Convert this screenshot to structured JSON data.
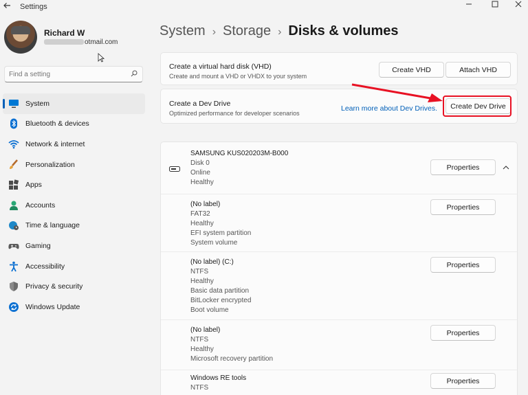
{
  "app": {
    "title": "Settings"
  },
  "user": {
    "name": "Richard W",
    "email_visible_part": "otmail.com"
  },
  "search": {
    "placeholder": "Find a setting"
  },
  "nav": [
    {
      "label": "System",
      "icon": "monitor-icon",
      "active": true
    },
    {
      "label": "Bluetooth & devices",
      "icon": "bluetooth-icon"
    },
    {
      "label": "Network & internet",
      "icon": "wifi-icon"
    },
    {
      "label": "Personalization",
      "icon": "brush-icon"
    },
    {
      "label": "Apps",
      "icon": "apps-icon"
    },
    {
      "label": "Accounts",
      "icon": "person-icon"
    },
    {
      "label": "Time & language",
      "icon": "globe-clock-icon"
    },
    {
      "label": "Gaming",
      "icon": "gamepad-icon"
    },
    {
      "label": "Accessibility",
      "icon": "accessibility-icon"
    },
    {
      "label": "Privacy & security",
      "icon": "shield-icon"
    },
    {
      "label": "Windows Update",
      "icon": "update-icon"
    }
  ],
  "breadcrumb": [
    "System",
    "Storage",
    "Disks & volumes"
  ],
  "vhd": {
    "title": "Create a virtual hard disk (VHD)",
    "subtitle": "Create and mount a VHD or VHDX to your system",
    "create_label": "Create VHD",
    "attach_label": "Attach VHD"
  },
  "devdrive": {
    "title": "Create a Dev Drive",
    "subtitle": "Optimized performance for developer scenarios",
    "link_label": "Learn more about Dev Drives.",
    "button_label": "Create Dev Drive"
  },
  "disk": {
    "lines": [
      "SAMSUNG KUS020203M-B000",
      "Disk 0",
      "Online",
      "Healthy"
    ],
    "button_label": "Properties",
    "expanded": true
  },
  "volumes": [
    {
      "lines": [
        "(No label)",
        "FAT32",
        "Healthy",
        "EFI system partition",
        "System volume"
      ],
      "button_label": "Properties"
    },
    {
      "lines": [
        "(No label) (C:)",
        "NTFS",
        "Healthy",
        "Basic data partition",
        "BitLocker encrypted",
        "Boot volume"
      ],
      "button_label": "Properties"
    },
    {
      "lines": [
        "(No label)",
        "NTFS",
        "Healthy",
        "Microsoft recovery partition"
      ],
      "button_label": "Properties"
    },
    {
      "lines": [
        "Windows RE tools",
        "NTFS"
      ],
      "button_label": "Properties"
    }
  ],
  "colors": {
    "accent": "#005fb8",
    "highlight": "#e81123"
  }
}
